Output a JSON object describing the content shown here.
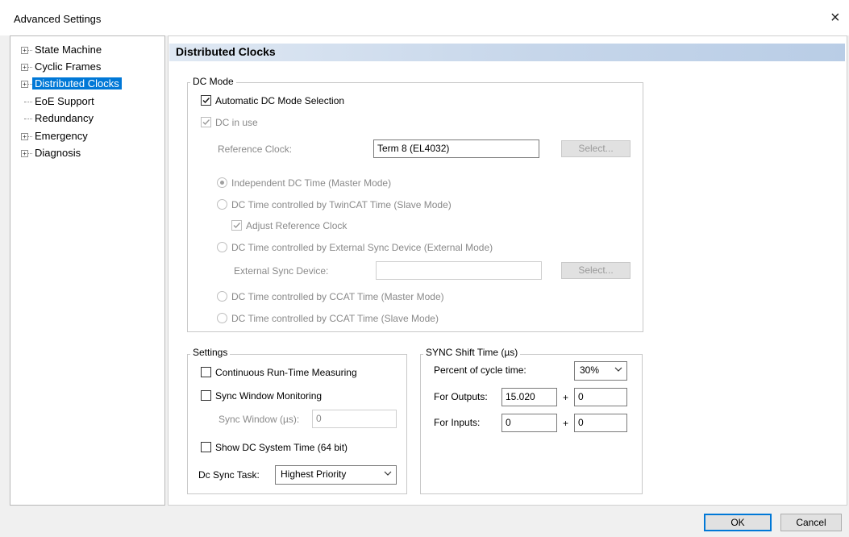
{
  "window": {
    "title": "Advanced Settings",
    "close_glyph": "×"
  },
  "tree": {
    "items": [
      {
        "label": "State Machine",
        "expandable": true
      },
      {
        "label": "Cyclic Frames",
        "expandable": true
      },
      {
        "label": "Distributed Clocks",
        "expandable": true,
        "selected": true
      },
      {
        "label": "EoE Support",
        "expandable": false
      },
      {
        "label": "Redundancy",
        "expandable": false
      },
      {
        "label": "Emergency",
        "expandable": true
      },
      {
        "label": "Diagnosis",
        "expandable": true
      }
    ],
    "expander_glyph": "+"
  },
  "panel": {
    "title": "Distributed Clocks"
  },
  "dc_mode": {
    "group_label": "DC Mode",
    "auto_selection": {
      "label": "Automatic DC Mode Selection",
      "checked": true
    },
    "dc_in_use": {
      "label": "DC in use",
      "checked": true,
      "disabled": true
    },
    "reference_clock": {
      "label": "Reference Clock:",
      "value": "Term 8 (EL4032)",
      "select_label": "Select..."
    },
    "radios": [
      {
        "label": "Independent DC Time (Master Mode)",
        "selected": true
      },
      {
        "label": "DC Time controlled by TwinCAT Time (Slave Mode)",
        "selected": false
      },
      {
        "label": "DC Time controlled by External Sync Device (External Mode)",
        "selected": false
      },
      {
        "label": "DC Time controlled by CCAT Time (Master Mode)",
        "selected": false
      },
      {
        "label": "DC Time controlled by CCAT Time (Slave Mode)",
        "selected": false
      }
    ],
    "adjust_reference": {
      "label": "Adjust Reference Clock",
      "checked": true
    },
    "external_sync": {
      "label": "External Sync Device:",
      "value": "",
      "select_label": "Select..."
    }
  },
  "settings": {
    "group_label": "Settings",
    "continuous": {
      "label": "Continuous Run-Time Measuring",
      "checked": false
    },
    "sync_window_monitoring": {
      "label": "Sync Window Monitoring",
      "checked": false
    },
    "sync_window": {
      "label": "Sync Window (µs):",
      "value": "0"
    },
    "show_dc_time": {
      "label": "Show DC System Time (64 bit)",
      "checked": false
    },
    "dc_sync_task": {
      "label": "Dc Sync Task:",
      "value": "Highest Priority"
    }
  },
  "sync_shift": {
    "group_label": "SYNC Shift Time (µs)",
    "percent": {
      "label": "Percent of cycle time:",
      "value": "30%"
    },
    "outputs": {
      "label": "For Outputs:",
      "value": "15.020",
      "plus": "+",
      "offset": "0"
    },
    "inputs": {
      "label": "For Inputs:",
      "value": "0",
      "plus": "+",
      "offset": "0"
    }
  },
  "buttons": {
    "ok": "OK",
    "cancel": "Cancel"
  }
}
